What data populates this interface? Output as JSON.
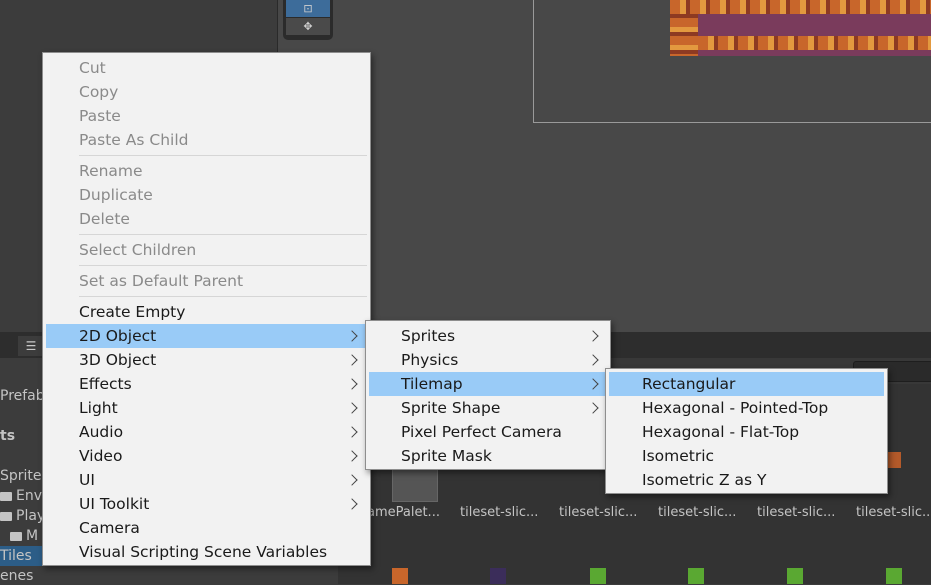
{
  "scene_toolbar": {
    "tool_rect_label": "⊡",
    "tool_transform_label": "✥"
  },
  "hierarchy": {
    "icon": "list-icon",
    "icon_glyph": "☰"
  },
  "project_panel": {
    "items": [
      {
        "label": "Prefab"
      },
      {
        "label": "ts"
      },
      {
        "label": "Sprites"
      },
      {
        "label": "Envi"
      },
      {
        "label": "Play"
      },
      {
        "label": "M"
      },
      {
        "label": "Tiles"
      },
      {
        "label": "enes"
      }
    ]
  },
  "assets": {
    "labels": [
      "amePalet...",
      "tileset-slic...",
      "tileset-slic...",
      "tileset-slic...",
      "tileset-slic...",
      "tileset-slic..."
    ]
  },
  "context_menu": {
    "items": [
      {
        "label": "Cut"
      },
      {
        "label": "Copy"
      },
      {
        "label": "Paste"
      },
      {
        "label": "Paste As Child"
      },
      {
        "label": "Rename"
      },
      {
        "label": "Duplicate"
      },
      {
        "label": "Delete"
      },
      {
        "label": "Select Children"
      },
      {
        "label": "Set as Default Parent"
      },
      {
        "label": "Create Empty"
      },
      {
        "label": "2D Object"
      },
      {
        "label": "3D Object"
      },
      {
        "label": "Effects"
      },
      {
        "label": "Light"
      },
      {
        "label": "Audio"
      },
      {
        "label": "Video"
      },
      {
        "label": "UI"
      },
      {
        "label": "UI Toolkit"
      },
      {
        "label": "Camera"
      },
      {
        "label": "Visual Scripting Scene Variables"
      }
    ]
  },
  "submenu_2d": {
    "items": [
      {
        "label": "Sprites"
      },
      {
        "label": "Physics"
      },
      {
        "label": "Tilemap"
      },
      {
        "label": "Sprite Shape"
      },
      {
        "label": "Pixel Perfect Camera"
      },
      {
        "label": "Sprite Mask"
      }
    ]
  },
  "submenu_tilemap": {
    "items": [
      {
        "label": "Rectangular"
      },
      {
        "label": "Hexagonal - Pointed-Top"
      },
      {
        "label": "Hexagonal - Flat-Top"
      },
      {
        "label": "Isometric"
      },
      {
        "label": "Isometric Z as Y"
      }
    ]
  },
  "colors": {
    "menu_bg": "#f2f2f2",
    "highlight": "#99cbf7",
    "disabled_text": "#8a8a8a",
    "editor_bg": "#383838"
  }
}
